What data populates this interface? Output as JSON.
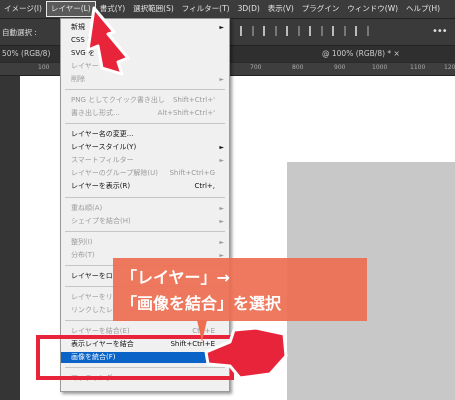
{
  "menubar": {
    "items": [
      "イメージ(I)",
      "レイヤー(L)",
      "書式(Y)",
      "選択範囲(S)",
      "フィルター(T)",
      "3D(D)",
      "表示(V)",
      "プラグイン",
      "ウィンドウ(W)",
      "ヘルプ(H)"
    ]
  },
  "options_bar": {
    "label": "自動選択 :",
    "more": "•••"
  },
  "tabs": {
    "left": "50% (RGB/8)",
    "right": "@ 100% (RGB/8) * ×"
  },
  "ruler": {
    "ticks": [
      "100",
      "700",
      "800",
      "900",
      "1000",
      "1100",
      "1200"
    ]
  },
  "menu": {
    "items": [
      {
        "label": "新規",
        "shortcut": "",
        "arrow": "►",
        "disabled": false
      },
      {
        "label": "CSS を",
        "shortcut": "",
        "arrow": "",
        "disabled": false
      },
      {
        "label": "SVG を",
        "shortcut": "",
        "arrow": "",
        "disabled": false
      },
      {
        "label": "レイヤー",
        "shortcut": "",
        "arrow": "",
        "disabled": true
      },
      {
        "label": "削除",
        "shortcut": "",
        "arrow": "►",
        "disabled": true
      },
      {
        "label": "PNG としてクイック書き出し",
        "shortcut": "Shift+Ctrl+'",
        "arrow": "",
        "disabled": true
      },
      {
        "label": "書き出し形式...",
        "shortcut": "Alt+Shift+Ctrl+'",
        "arrow": "",
        "disabled": true
      },
      {
        "label": "レイヤー名の変更...",
        "shortcut": "",
        "arrow": "",
        "disabled": false
      },
      {
        "label": "レイヤースタイル(Y)",
        "shortcut": "",
        "arrow": "►",
        "disabled": false
      },
      {
        "label": "スマートフィルター",
        "shortcut": "",
        "arrow": "►",
        "disabled": true
      },
      {
        "label": "レイヤーのグループ解除(U)",
        "shortcut": "Shift+Ctrl+G",
        "arrow": "",
        "disabled": true
      },
      {
        "label": "レイヤーを表示(R)",
        "shortcut": "Ctrl+,",
        "arrow": "",
        "disabled": false
      },
      {
        "label": "重ね順(A)",
        "shortcut": "",
        "arrow": "►",
        "disabled": true
      },
      {
        "label": "シェイプを結合(H)",
        "shortcut": "",
        "arrow": "►",
        "disabled": true
      },
      {
        "label": "整列(I)",
        "shortcut": "",
        "arrow": "►",
        "disabled": true
      },
      {
        "label": "分布(T)",
        "shortcut": "",
        "arrow": "►",
        "disabled": true
      },
      {
        "label": "レイヤーをロ",
        "shortcut": "",
        "arrow": "",
        "disabled": false
      },
      {
        "label": "レイヤーをリ",
        "shortcut": "",
        "arrow": "",
        "disabled": true
      },
      {
        "label": "リンクしたレ",
        "shortcut": "",
        "arrow": "",
        "disabled": true
      },
      {
        "label": "レイヤーを結合(E)",
        "shortcut": "Ctrl+E",
        "arrow": "",
        "disabled": true
      },
      {
        "label": "表示レイヤーを結合",
        "shortcut": "Shift+Ctrl+E",
        "arrow": "",
        "disabled": false
      },
      {
        "label": "画像を統合(F)",
        "shortcut": "",
        "arrow": "",
        "disabled": false,
        "highlighted": true
      },
      {
        "label": "マッティング",
        "shortcut": "",
        "arrow": "►",
        "disabled": true
      }
    ]
  },
  "callout": {
    "line1": "「レイヤー」→",
    "line2": "「画像を結合」を選択"
  },
  "colors": {
    "accent_red": "#e8243a",
    "callout": "#ee6e50",
    "highlight": "#0a64c8"
  }
}
